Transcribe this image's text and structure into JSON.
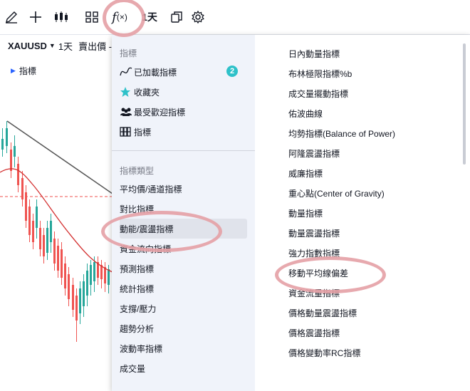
{
  "toolbar": {
    "interval": "1天"
  },
  "symbol_bar": {
    "symbol": "XAUUSD",
    "interval": "1天",
    "price_type": "賣出價 -"
  },
  "legend": {
    "label": "指標"
  },
  "sidebar": {
    "section1_title": "指標",
    "items": [
      {
        "label": "已加載指標",
        "icon": "wave-icon"
      },
      {
        "label": "收藏夾",
        "icon": "star-icon"
      },
      {
        "label": "最受歡迎指標",
        "icon": "users-icon"
      },
      {
        "label": "指標",
        "icon": "grid-icon"
      }
    ],
    "loaded_count": "2",
    "section2_title": "指標類型",
    "types": [
      "平均價/通道指標",
      "對比指標",
      "動能/震盪指標",
      "資金流向指標",
      "預測指標",
      "統計指標",
      "支撐/壓力",
      "趨勢分析",
      "波動率指標",
      "成交量"
    ],
    "active_type": "動能/震盪指標"
  },
  "indicator_list": [
    "日內動量指標",
    "布林極限指標%b",
    "成交量擺動指標",
    "佑波曲線",
    "均勢指標(Balance of Power)",
    "阿隆震盪指標",
    "威廉指標",
    "重心點(Center of Gravity)",
    "動量指標",
    "動量震盪指標",
    "強力指數指標",
    "移動平均線偏差",
    "資金流量指標",
    "價格動量震盪指標",
    "價格震盪指標",
    "價格變動率RC指標"
  ],
  "colors": {
    "accent": "#2962ff",
    "highlight_circle": "#e4a0a5",
    "badge": "#2ec1c9",
    "candle_up": "#26a69a",
    "candle_down": "#ef5350",
    "ma_line": "#d32f2f"
  },
  "icons": [
    "draw-icon",
    "crosshair-plus-icon",
    "candles-icon",
    "layout-icon",
    "function-icon",
    "compare-icon",
    "gear-icon"
  ]
}
